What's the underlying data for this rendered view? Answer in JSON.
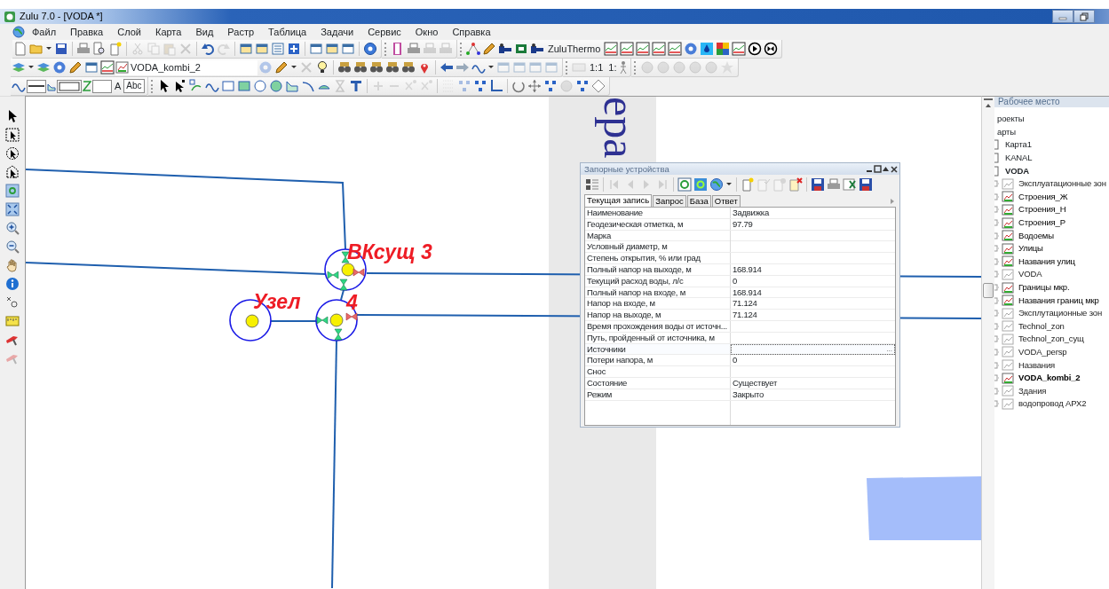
{
  "window": {
    "title": "Zulu 7.0 - [VODA *]"
  },
  "menu": [
    "Файл",
    "Правка",
    "Слой",
    "Карта",
    "Вид",
    "Растр",
    "Таблица",
    "Задачи",
    "Сервис",
    "Окно",
    "Справка"
  ],
  "toolbar": {
    "plugin_label": "ZuluThermo",
    "layer_combo": "VODA_kombi_2",
    "scale_buttons": [
      "1:1",
      "1:"
    ],
    "font_label": "A",
    "text_sample": "Abc"
  },
  "map": {
    "raster_label": "ера",
    "labels": [
      "ВКсущ 3",
      "Узел",
      "4"
    ]
  },
  "dialog": {
    "title": "Запорные устройства",
    "tabs": [
      {
        "label": "Текущая запись",
        "selected": true
      },
      {
        "label": "Запрос",
        "selected": false
      },
      {
        "label": "База",
        "selected": false
      },
      {
        "label": "Ответ",
        "selected": false
      }
    ],
    "rows": [
      {
        "name": "Наименование",
        "value": "Задвижка",
        "selected": false
      },
      {
        "name": "Геодезическая отметка, м",
        "value": "97.79",
        "selected": false
      },
      {
        "name": "Марка",
        "selected": false
      },
      {
        "name": "Условный диаметр, м",
        "selected": false
      },
      {
        "name": "Степень открытия, % или град",
        "selected": false
      },
      {
        "name": "Полный напор на выходе, м",
        "value": "168.914",
        "selected": false
      },
      {
        "name": "Текущий расход воды, л/с",
        "value": "0",
        "selected": false
      },
      {
        "name": "Полный напор на входе, м",
        "value": "168.914",
        "selected": false
      },
      {
        "name": "Напор на входе, м",
        "value": "71.124",
        "selected": false
      },
      {
        "name": "Напор на выходе, м",
        "value": "71.124",
        "selected": false
      },
      {
        "name": "Время прохождения воды от источн...",
        "selected": false
      },
      {
        "name": "Путь, пройденный от источника, м",
        "selected": false
      },
      {
        "name": "Источники",
        "selected": true,
        "editor_button": "..."
      },
      {
        "name": "Потери напора, м",
        "value": "0",
        "selected": false
      },
      {
        "name": "Снос",
        "selected": false
      },
      {
        "name": "Состояние",
        "value": "Существует",
        "selected": false
      },
      {
        "name": "Режим",
        "value": "Закрыто",
        "selected": false
      }
    ]
  },
  "workspace": {
    "title": "Рабочее место",
    "tree": [
      {
        "label": "роекты",
        "kind": "folder"
      },
      {
        "label": "арты",
        "kind": "folder",
        "children": [
          {
            "label": "Карта1",
            "kind": "map",
            "active": false
          },
          {
            "label": "KANAL",
            "kind": "map",
            "active": false
          },
          {
            "label": "VODA",
            "kind": "map",
            "active": true,
            "children": [
              {
                "label": "Эксплуатационные зон",
                "kind": "layer",
                "visible": false,
                "active": false
              },
              {
                "label": "Строения_Ж",
                "kind": "layer",
                "visible": true,
                "active": false
              },
              {
                "label": "Строения_Н",
                "kind": "layer",
                "visible": true,
                "active": false
              },
              {
                "label": "Строения_Р",
                "kind": "layer",
                "visible": true,
                "active": false
              },
              {
                "label": "Водоемы",
                "kind": "layer",
                "visible": true,
                "active": false
              },
              {
                "label": "Улицы",
                "kind": "layer",
                "visible": true,
                "active": false
              },
              {
                "label": "Названия улиц",
                "kind": "layer",
                "visible": true,
                "active": false
              },
              {
                "label": "VODA",
                "kind": "layer",
                "visible": false,
                "active": false
              },
              {
                "label": "Границы мкр.",
                "kind": "layer",
                "visible": true,
                "active": false
              },
              {
                "label": "Названия границ мкр",
                "kind": "layer",
                "visible": true,
                "active": false
              },
              {
                "label": "Эксплутационные зон",
                "kind": "layer",
                "visible": false,
                "active": false
              },
              {
                "label": "Technol_zon",
                "kind": "layer",
                "visible": false,
                "active": false
              },
              {
                "label": "Technol_zon_сущ",
                "kind": "layer",
                "visible": false,
                "active": false
              },
              {
                "label": "VODA_persp",
                "kind": "layer",
                "visible": false,
                "active": false
              },
              {
                "label": "Названия",
                "kind": "layer",
                "visible": false,
                "active": false
              },
              {
                "label": "VODA_kombi_2",
                "kind": "layer",
                "visible": true,
                "active": true
              },
              {
                "label": "Здания",
                "kind": "layer",
                "visible": false,
                "active": false
              },
              {
                "label": "водопровод АРХ2",
                "kind": "layer",
                "visible": false,
                "active": false
              }
            ]
          }
        ]
      }
    ]
  }
}
